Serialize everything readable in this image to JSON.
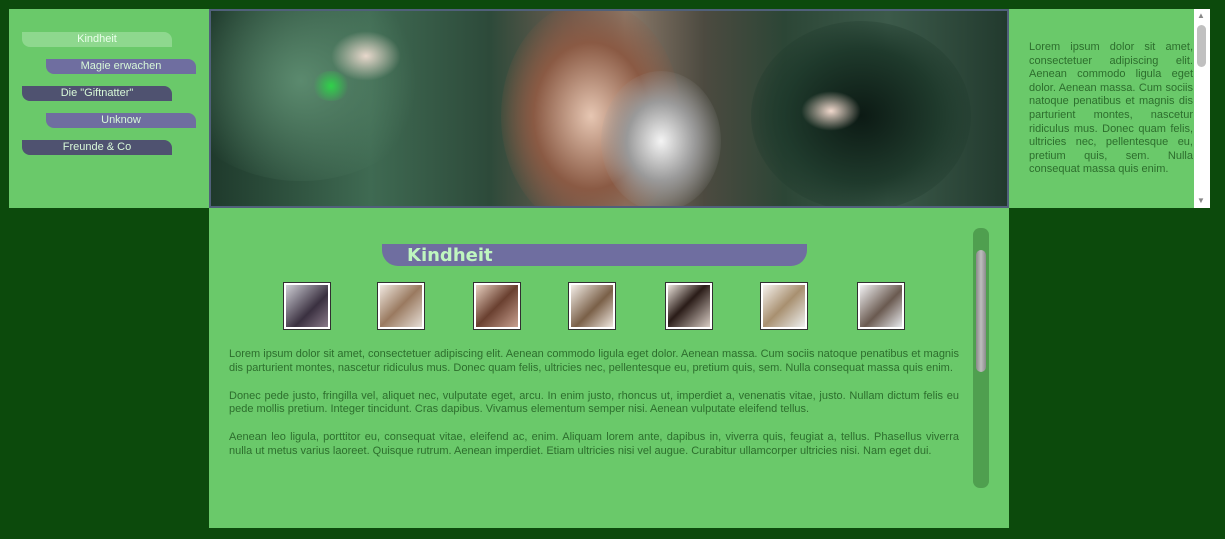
{
  "nav": {
    "items": [
      {
        "label": "Kindheit"
      },
      {
        "label": "Magie erwachen"
      },
      {
        "label": "Die \"Giftnatter\""
      },
      {
        "label": "Unknow"
      },
      {
        "label": "Freunde & Co"
      }
    ]
  },
  "sidebar": {
    "text": "Lorem ipsum dolor sit amet, consectetuer adipiscing elit. Aenean commodo ligula eget dolor. Aenean massa. Cum sociis natoque penatibus et magnis dis parturient montes, nascetur ridiculus mus. Donec quam felis, ultricies nec, pellentesque eu, pretium quis, sem. Nulla consequat massa quis enim."
  },
  "main": {
    "title": "Kindheit",
    "paragraphs": [
      "Lorem ipsum dolor sit amet, consectetuer adipiscing elit. Aenean commodo ligula eget dolor. Aenean massa. Cum sociis natoque penatibus et magnis dis parturient montes, nascetur ridiculus mus. Donec quam felis, ultricies nec, pellentesque eu, pretium quis, sem. Nulla consequat massa quis enim.",
      "Donec pede justo, fringilla vel, aliquet nec, vulputate eget, arcu. In enim justo, rhoncus ut, imperdiet a, venenatis vitae, justo. Nullam dictum felis eu pede mollis pretium. Integer tincidunt. Cras dapibus. Vivamus elementum semper nisi. Aenean vulputate eleifend tellus.",
      "Aenean leo ligula, porttitor eu, consequat vitae, eleifend ac, enim. Aliquam lorem ante, dapibus in, viverra quis, feugiat a, tellus. Phasellus viverra nulla ut metus varius laoreet. Quisque rutrum. Aenean imperdiet. Etiam ultricies nisi vel augue. Curabitur ullamcorper ultricies nisi. Nam eget dui."
    ]
  },
  "colors": {
    "page_bg": "#0c4a0c",
    "panel_bg": "#6ac96a",
    "accent_purple": "#6f6ea0",
    "text_green": "#2d6e2d"
  }
}
